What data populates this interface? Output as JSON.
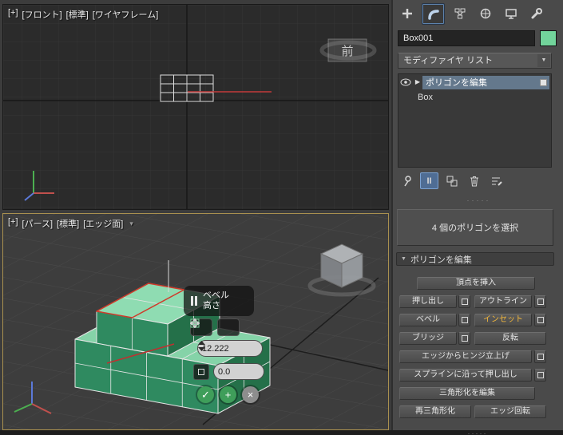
{
  "viewport_front": {
    "labels": {
      "plus": "[+]",
      "view": "[フロント]",
      "style": "[標準]",
      "shading": "[ワイヤフレーム]"
    },
    "viewcube": "前"
  },
  "viewport_persp": {
    "labels": {
      "plus": "[+]",
      "view": "[パース]",
      "style": "[標準]",
      "shading": "[エッジ面]"
    },
    "caddy": {
      "tool": "ベベル",
      "param": "高さ",
      "value_height": "12.222",
      "value_outline": "0.0"
    }
  },
  "command_panel": {
    "object_name": "Box001",
    "modifier_list": "モディファイヤ リスト",
    "stack": [
      {
        "label": "ポリゴンを編集"
      },
      {
        "label": "Box"
      }
    ],
    "selection_status": "4 個のポリゴンを選択",
    "rollout": {
      "title": "ポリゴンを編集",
      "insert_vertex": "頂点を挿入",
      "extrude": "押し出し",
      "outline": "アウトライン",
      "bevel": "ベベル",
      "inset": "インセット",
      "bridge": "ブリッジ",
      "flip": "反転",
      "hinge_from_edge": "エッジからヒンジ立上げ",
      "extrude_along_spline": "スプラインに沿って押し出し",
      "edit_triangulation": "三角形化を編集",
      "retriangulate": "再三角形化",
      "turn": "エッジ回転"
    }
  },
  "icons": {
    "dropdown_arrow": "▼",
    "rollout_arrow": "▼",
    "stack_expand_arrow": "▶",
    "view_flag": "▾",
    "show_end_result": "II",
    "caddy_ok": "✓",
    "caddy_apply": "+",
    "caddy_cancel": "×",
    "grip_dots": "·····"
  },
  "colors": {
    "object_green_top": "#8fdcb2",
    "object_green_front": "#2f8a60",
    "object_green_right": "#247049",
    "swatch_green": "#72d49b",
    "selection_red": "#cf3a2a",
    "active_viewport_border": "#a9904f"
  }
}
